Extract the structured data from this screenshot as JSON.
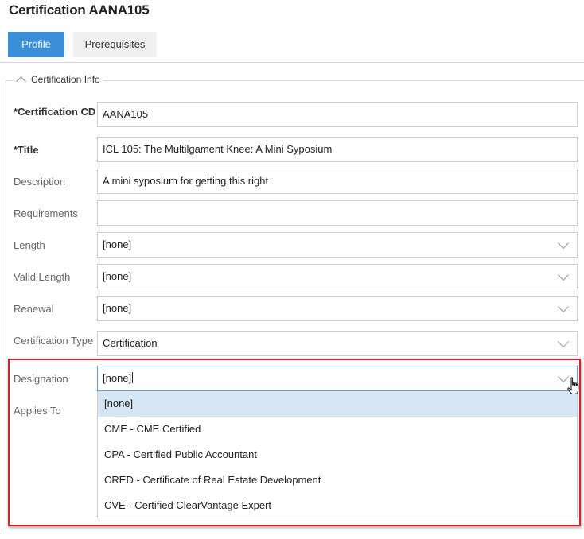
{
  "page": {
    "title": "Certification AANA105"
  },
  "tabs": [
    {
      "label": "Profile",
      "active": true
    },
    {
      "label": "Prerequisites",
      "active": false
    }
  ],
  "section": {
    "legend": "Certification Info",
    "collapse_icon": "chevron-up-icon"
  },
  "fields": {
    "certification_cd": {
      "label": "*Certification CD",
      "value": "AANA105"
    },
    "title": {
      "label": "*Title",
      "value": "ICL 105: The Multilgament Knee: A Mini Syposium"
    },
    "description": {
      "label": "Description",
      "value": "A mini syposium for getting this right"
    },
    "requirements": {
      "label": "Requirements",
      "value": ""
    },
    "length": {
      "label": "Length",
      "value": "[none]"
    },
    "valid_length": {
      "label": "Valid Length",
      "value": "[none]"
    },
    "renewal": {
      "label": "Renewal",
      "value": "[none]"
    },
    "certification_type": {
      "label": "Certification Type",
      "value": "Certification"
    },
    "designation": {
      "label": "Designation",
      "value": "[none]"
    },
    "applies_to": {
      "label": "Applies To"
    }
  },
  "designation_options": [
    {
      "label": "[none]",
      "selected": true
    },
    {
      "label": "CME - CME Certified",
      "selected": false
    },
    {
      "label": "CPA - Certified Public Accountant",
      "selected": false
    },
    {
      "label": "CRED - Certificate of Real Estate Development",
      "selected": false
    },
    {
      "label": "CVE - Certified ClearVantage Expert",
      "selected": false
    }
  ],
  "colors": {
    "accent": "#3a8fd6",
    "highlight_border": "#c9252b",
    "option_selected_bg": "#d6e6f5"
  }
}
